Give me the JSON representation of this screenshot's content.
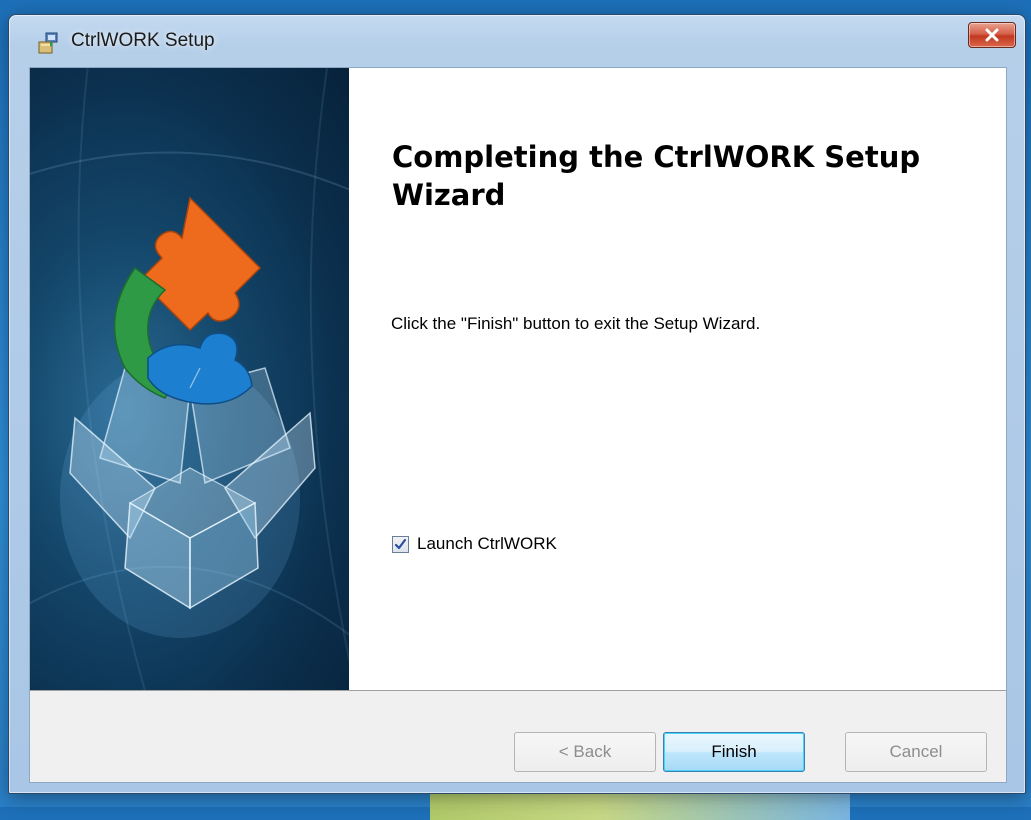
{
  "window": {
    "title": "CtrlWORK Setup",
    "icon": "installer-icon",
    "close_icon": "close-icon"
  },
  "banner": {
    "logo": "puzzle-box-logo"
  },
  "main": {
    "heading": "Completing the CtrlWORK Setup Wizard",
    "description": "Click the \"Finish\" button to exit the Setup Wizard.",
    "launch_checkbox": {
      "label": "Launch CtrlWORK",
      "checked": true
    }
  },
  "buttons": {
    "back": "< Back",
    "finish": "Finish",
    "cancel": "Cancel"
  },
  "colors": {
    "banner_bg": "#0b2f4d",
    "puzzle_orange": "#ee6a1c",
    "puzzle_green": "#2e9a46",
    "puzzle_blue": "#1d7fd0",
    "default_button_border": "#3c7fb1"
  }
}
